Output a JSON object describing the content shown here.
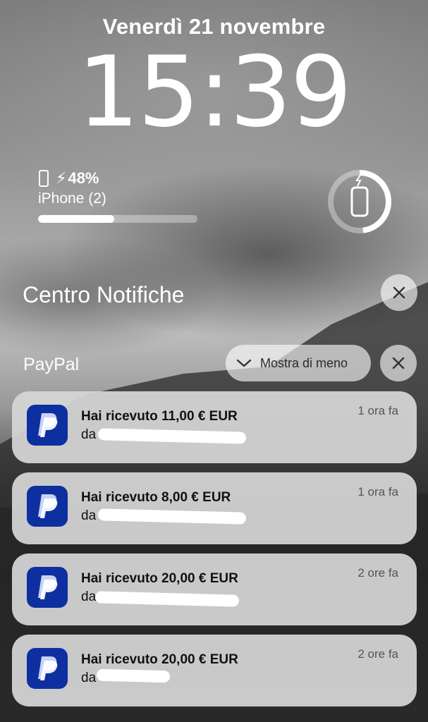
{
  "lockscreen": {
    "date": "Venerdì 21 novembre",
    "time": "15:39"
  },
  "battery_widget": {
    "percent_label": "48%",
    "level": 0.48,
    "device_name": "iPhone (2)",
    "icons": [
      "phone-outline-icon",
      "charging-bolt-icon"
    ]
  },
  "notification_center": {
    "title": "Centro Notifiche",
    "close_icon": "close-icon",
    "group": {
      "app_name": "PayPal",
      "show_less_label": "Mostra di meno",
      "notifications": [
        {
          "title": "Hai ricevuto 11,00 € EUR",
          "from_prefix": "da",
          "when": "1 ora fa"
        },
        {
          "title": "Hai ricevuto 8,00 € EUR",
          "from_prefix": "da",
          "when": "1 ora fa"
        },
        {
          "title": "Hai ricevuto 20,00 € EUR",
          "from_prefix": "da",
          "when": "2 ore fa"
        },
        {
          "title": "Hai ricevuto 20,00 € EUR",
          "from_prefix": "da",
          "when": "2 ore fa"
        }
      ]
    }
  },
  "colors": {
    "paypal_blue": "#0d2fa0",
    "card_bg": "#d6d6d6"
  }
}
